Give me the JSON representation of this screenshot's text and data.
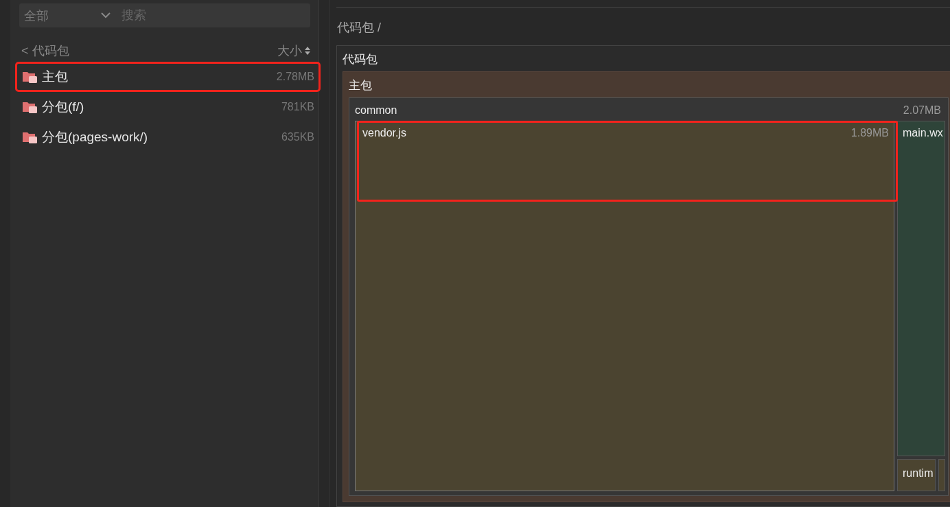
{
  "filter": {
    "scope": "全部",
    "search_placeholder": "搜索"
  },
  "list_header": {
    "back": "< 代码包",
    "sort": "大小"
  },
  "packages": [
    {
      "name": "主包",
      "size": "2.78MB",
      "annotated": true
    },
    {
      "name": "分包(f/)",
      "size": "781KB",
      "annotated": false
    },
    {
      "name": "分包(pages-work/)",
      "size": "635KB",
      "annotated": false
    }
  ],
  "breadcrumb": "代码包 /",
  "treemap": {
    "title": "代码包",
    "package": "主包",
    "group": {
      "name": "common",
      "size": "2.07MB"
    },
    "files": [
      {
        "kind": "main",
        "name": "vendor.js",
        "size": "1.89MB",
        "annotated": true
      },
      {
        "kind": "side",
        "name": "main.wx"
      },
      {
        "kind": "bottom",
        "name": "runtim"
      }
    ]
  }
}
